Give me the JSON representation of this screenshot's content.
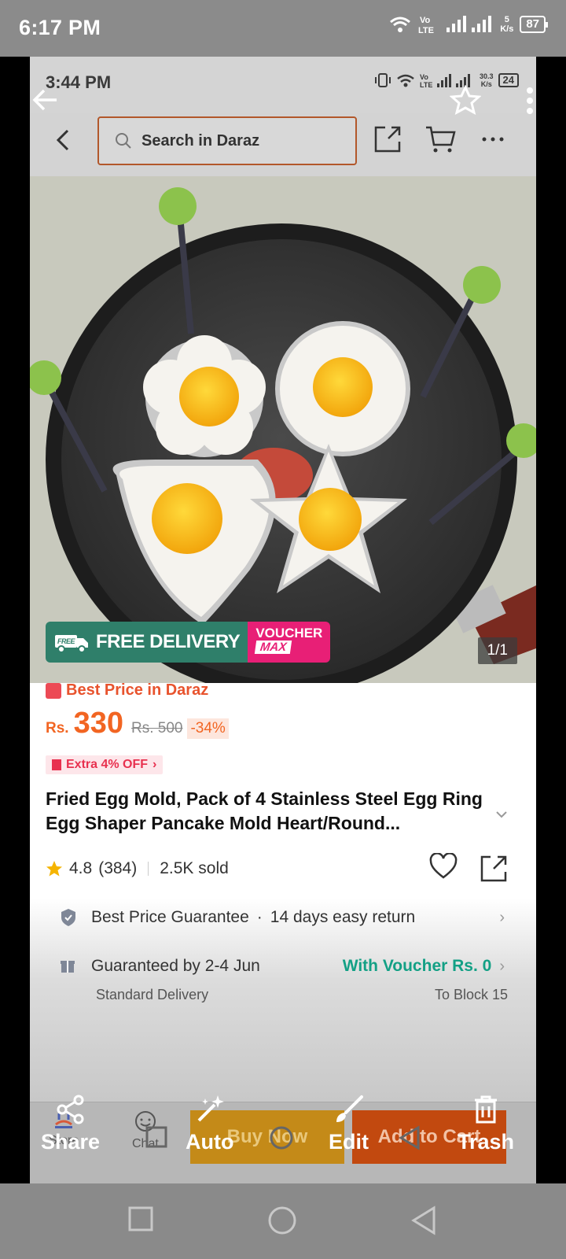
{
  "outer_status": {
    "time": "6:17 PM",
    "speed": "5",
    "speed_unit": "K/s",
    "battery": "87"
  },
  "inner_status": {
    "time": "3:44 PM",
    "speed": "30.3",
    "speed_unit": "K/s",
    "battery": "24"
  },
  "header": {
    "search_placeholder": "Search in Daraz"
  },
  "image": {
    "badge_free": "FREE DELIVERY",
    "badge_free_small": "FREE",
    "badge_voucher": "VOUCHER",
    "badge_max": "MAX",
    "counter": "1/1"
  },
  "price": {
    "best_price": "Best Price in Daraz",
    "currency": "Rs.",
    "current": "330",
    "original": "Rs. 500",
    "discount": "-34%",
    "extra_off": "Extra 4% OFF"
  },
  "product": {
    "title": "Fried Egg Mold, Pack of 4 Stainless Steel Egg Ring Egg Shaper Pancake Mold Heart/Round...",
    "rating": "4.8",
    "reviews": "(384)",
    "sold": "2.5K sold"
  },
  "info": {
    "guarantee": "Best Price Guarantee",
    "return": "14 days easy return",
    "delivery": "Guaranteed by 2-4 Jun",
    "voucher": "With Voucher Rs. 0",
    "delivery_type": "Standard Delivery",
    "destination": "To Block 15"
  },
  "bottom_bar": {
    "store": "Store",
    "chat": "Chat",
    "buy_now": "Buy Now",
    "add_to_cart": "Add to Cart"
  },
  "gallery_bar": {
    "share": "Share",
    "auto": "Auto",
    "edit": "Edit",
    "trash": "Trash"
  },
  "colors": {
    "accent_orange": "#f26522",
    "green": "#13a085",
    "delivery_green": "#2f7f6a",
    "voucher_pink": "#e81f76"
  }
}
